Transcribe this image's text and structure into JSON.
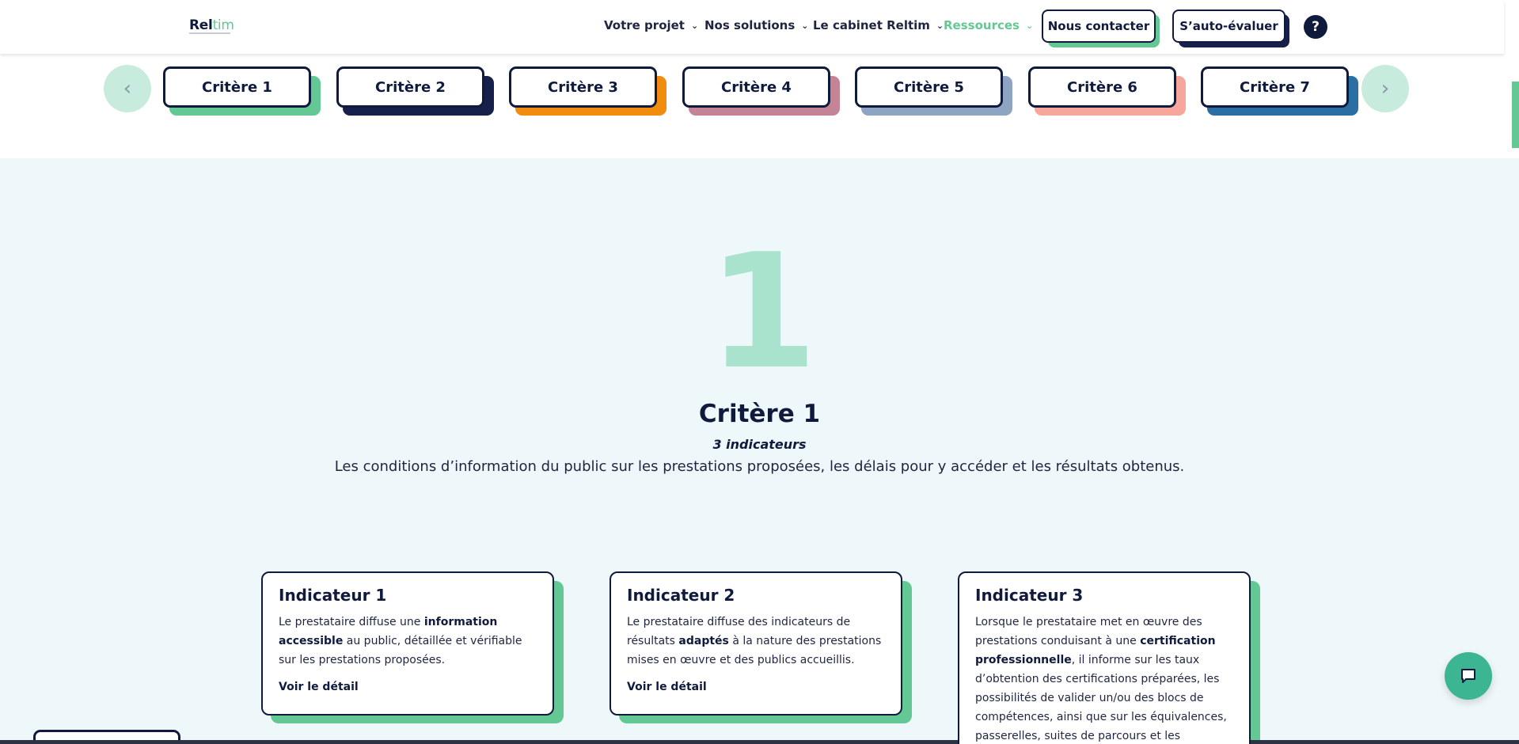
{
  "header": {
    "logo": {
      "part1": "Rel",
      "part2": "tim"
    },
    "nav": [
      {
        "label": "Votre projet",
        "active": false
      },
      {
        "label": "Nos solutions",
        "active": false
      },
      {
        "label": "Le cabinet Reltim",
        "active": false
      },
      {
        "label": "Ressources",
        "active": true
      }
    ],
    "contact_label": "Nous contacter",
    "self_eval_label": "S’auto-évaluer",
    "help_label": "?"
  },
  "criteria_tabs": [
    {
      "label": "Critère 1",
      "color": "#63c893"
    },
    {
      "label": "Critère 2",
      "color": "#16204a"
    },
    {
      "label": "Critère 3",
      "color": "#f28c0f"
    },
    {
      "label": "Critère 4",
      "color": "#c48496"
    },
    {
      "label": "Critère 5",
      "color": "#8ea4c3"
    },
    {
      "label": "Critère 6",
      "color": "#f7a69b"
    },
    {
      "label": "Critère 7",
      "color": "#2a6ea3"
    }
  ],
  "criterion": {
    "number": "1",
    "title": "Critère 1",
    "count": "3 indicateurs",
    "description": "Les conditions d’information du public sur les prestations proposées, les délais pour y accéder et les résultats obtenus."
  },
  "indicators": [
    {
      "title": "Indicateur 1",
      "detail_label": "Voir le détail"
    },
    {
      "title": "Indicateur 2",
      "detail_label": "Voir le détail"
    },
    {
      "title": "Indicateur 3"
    }
  ],
  "colors": {
    "accent": "#63c893",
    "navy": "#0f1a3d",
    "section_bg": "#eef8fb"
  }
}
